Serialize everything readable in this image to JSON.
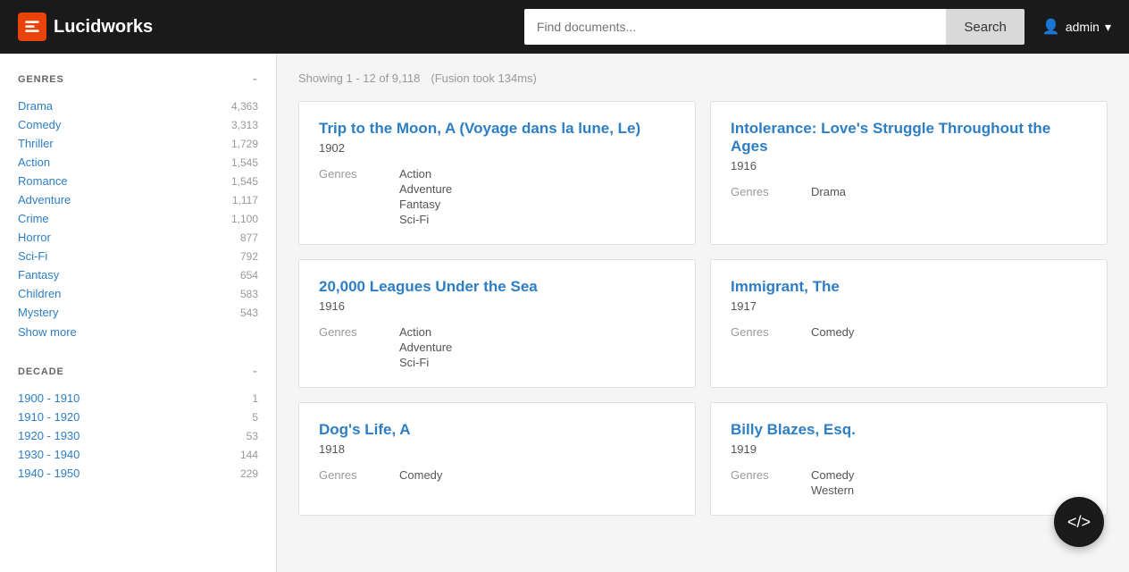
{
  "header": {
    "logo_text": "Lucidworks",
    "search_placeholder": "Find documents...",
    "search_button_label": "Search",
    "admin_label": "admin"
  },
  "sidebar": {
    "genres_section": {
      "title": "GENRES",
      "toggle": "-",
      "items": [
        {
          "label": "Drama",
          "count": "4,363"
        },
        {
          "label": "Comedy",
          "count": "3,313"
        },
        {
          "label": "Thriller",
          "count": "1,729"
        },
        {
          "label": "Action",
          "count": "1,545"
        },
        {
          "label": "Romance",
          "count": "1,545"
        },
        {
          "label": "Adventure",
          "count": "1,117"
        },
        {
          "label": "Crime",
          "count": "1,100"
        },
        {
          "label": "Horror",
          "count": "877"
        },
        {
          "label": "Sci-Fi",
          "count": "792"
        },
        {
          "label": "Fantasy",
          "count": "654"
        },
        {
          "label": "Children",
          "count": "583"
        },
        {
          "label": "Mystery",
          "count": "543"
        }
      ],
      "show_more": "Show more"
    },
    "decade_section": {
      "title": "DECADE",
      "toggle": "-",
      "items": [
        {
          "label": "1900 - 1910",
          "count": "1"
        },
        {
          "label": "1910 - 1920",
          "count": "5"
        },
        {
          "label": "1920 - 1930",
          "count": "53"
        },
        {
          "label": "1930 - 1940",
          "count": "144"
        },
        {
          "label": "1940 - 1950",
          "count": "229"
        }
      ]
    }
  },
  "results": {
    "showing_text": "Showing 1 - 12 of 9,118",
    "fusion_text": "(Fusion took 134ms)",
    "cards": [
      {
        "title": "Trip to the Moon, A (Voyage dans la lune, Le)",
        "year": "1902",
        "genres_label": "Genres",
        "genres": [
          "Action",
          "Adventure",
          "Fantasy",
          "Sci-Fi"
        ]
      },
      {
        "title": "Intolerance: Love's Struggle Throughout the Ages",
        "year": "1916",
        "genres_label": "Genres",
        "genres": [
          "Drama"
        ]
      },
      {
        "title": "20,000 Leagues Under the Sea",
        "year": "1916",
        "genres_label": "Genres",
        "genres": [
          "Action",
          "Adventure",
          "Sci-Fi"
        ]
      },
      {
        "title": "Immigrant, The",
        "year": "1917",
        "genres_label": "Genres",
        "genres": [
          "Comedy"
        ]
      },
      {
        "title": "Dog's Life, A",
        "year": "1918",
        "genres_label": "Genres",
        "genres": [
          "Comedy"
        ]
      },
      {
        "title": "Billy Blazes, Esq.",
        "year": "1919",
        "genres_label": "Genres",
        "genres": [
          "Comedy",
          "Western"
        ]
      }
    ]
  },
  "fab": {
    "label": "</>"
  }
}
